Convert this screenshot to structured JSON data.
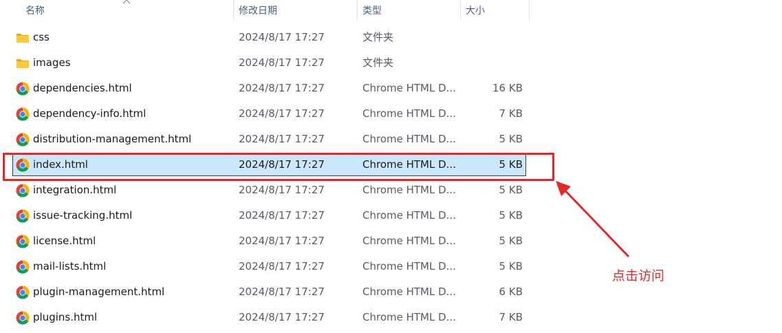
{
  "header": {
    "name": "名称",
    "modified": "修改日期",
    "type": "类型",
    "size": "大小"
  },
  "files": [
    {
      "name": "css",
      "modified": "2024/8/17 17:27",
      "type": "文件夹",
      "size": "",
      "icon": "folder-icon"
    },
    {
      "name": "images",
      "modified": "2024/8/17 17:27",
      "type": "文件夹",
      "size": "",
      "icon": "folder-icon"
    },
    {
      "name": "dependencies.html",
      "modified": "2024/8/17 17:27",
      "type": "Chrome HTML D...",
      "size": "16 KB",
      "icon": "chrome-icon"
    },
    {
      "name": "dependency-info.html",
      "modified": "2024/8/17 17:27",
      "type": "Chrome HTML D...",
      "size": "7 KB",
      "icon": "chrome-icon"
    },
    {
      "name": "distribution-management.html",
      "modified": "2024/8/17 17:27",
      "type": "Chrome HTML D...",
      "size": "5 KB",
      "icon": "chrome-icon"
    },
    {
      "name": "index.html",
      "modified": "2024/8/17 17:27",
      "type": "Chrome HTML D...",
      "size": "5 KB",
      "icon": "chrome-icon",
      "selected": true
    },
    {
      "name": "integration.html",
      "modified": "2024/8/17 17:27",
      "type": "Chrome HTML D...",
      "size": "5 KB",
      "icon": "chrome-icon"
    },
    {
      "name": "issue-tracking.html",
      "modified": "2024/8/17 17:27",
      "type": "Chrome HTML D...",
      "size": "5 KB",
      "icon": "chrome-icon"
    },
    {
      "name": "license.html",
      "modified": "2024/8/17 17:27",
      "type": "Chrome HTML D...",
      "size": "5 KB",
      "icon": "chrome-icon"
    },
    {
      "name": "mail-lists.html",
      "modified": "2024/8/17 17:27",
      "type": "Chrome HTML D...",
      "size": "5 KB",
      "icon": "chrome-icon"
    },
    {
      "name": "plugin-management.html",
      "modified": "2024/8/17 17:27",
      "type": "Chrome HTML D...",
      "size": "6 KB",
      "icon": "chrome-icon"
    },
    {
      "name": "plugins.html",
      "modified": "2024/8/17 17:27",
      "type": "Chrome HTML D...",
      "size": "7 KB",
      "icon": "chrome-icon"
    }
  ],
  "annotation": {
    "label": "点击访问",
    "color": "#e32626"
  },
  "colors": {
    "selection": "#cce8ff",
    "header_text": "#4c607a",
    "folder": "#ffc83d"
  }
}
